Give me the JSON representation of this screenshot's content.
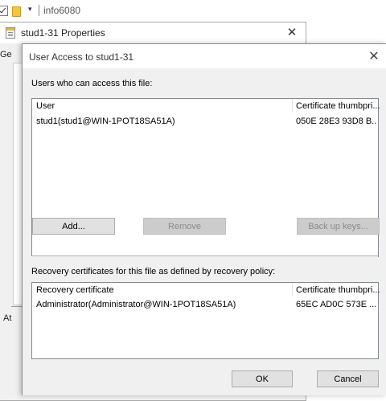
{
  "explorer": {
    "title": "info6080",
    "dropdown_glyph": "▾"
  },
  "properties_window": {
    "title": "stud1-31 Properties",
    "close_glyph": "✕",
    "tab_peek": "Ge",
    "body_peek": "At"
  },
  "dialog": {
    "title": "User Access to stud1-31",
    "close_glyph": "✕",
    "users_label": "Users who can access this file:",
    "users_table": {
      "columns": [
        "User",
        "Certificate thumbpri..."
      ],
      "rows": [
        {
          "user": "stud1(stud1@WIN-1POT18SA51A)",
          "thumbprint": "050E 28E3 93D8 B..."
        }
      ]
    },
    "buttons": {
      "add": "Add...",
      "remove": "Remove",
      "backup": "Back up keys...",
      "ok": "OK",
      "cancel": "Cancel"
    },
    "recovery_label": "Recovery certificates for this file as defined by recovery policy:",
    "recovery_table": {
      "columns": [
        "Recovery certificate",
        "Certificate thumbpri..."
      ],
      "rows": [
        {
          "cert": "Administrator(Administrator@WIN-1POT18SA51A)",
          "thumbprint": "65EC AD0C 573E ..."
        }
      ]
    }
  }
}
